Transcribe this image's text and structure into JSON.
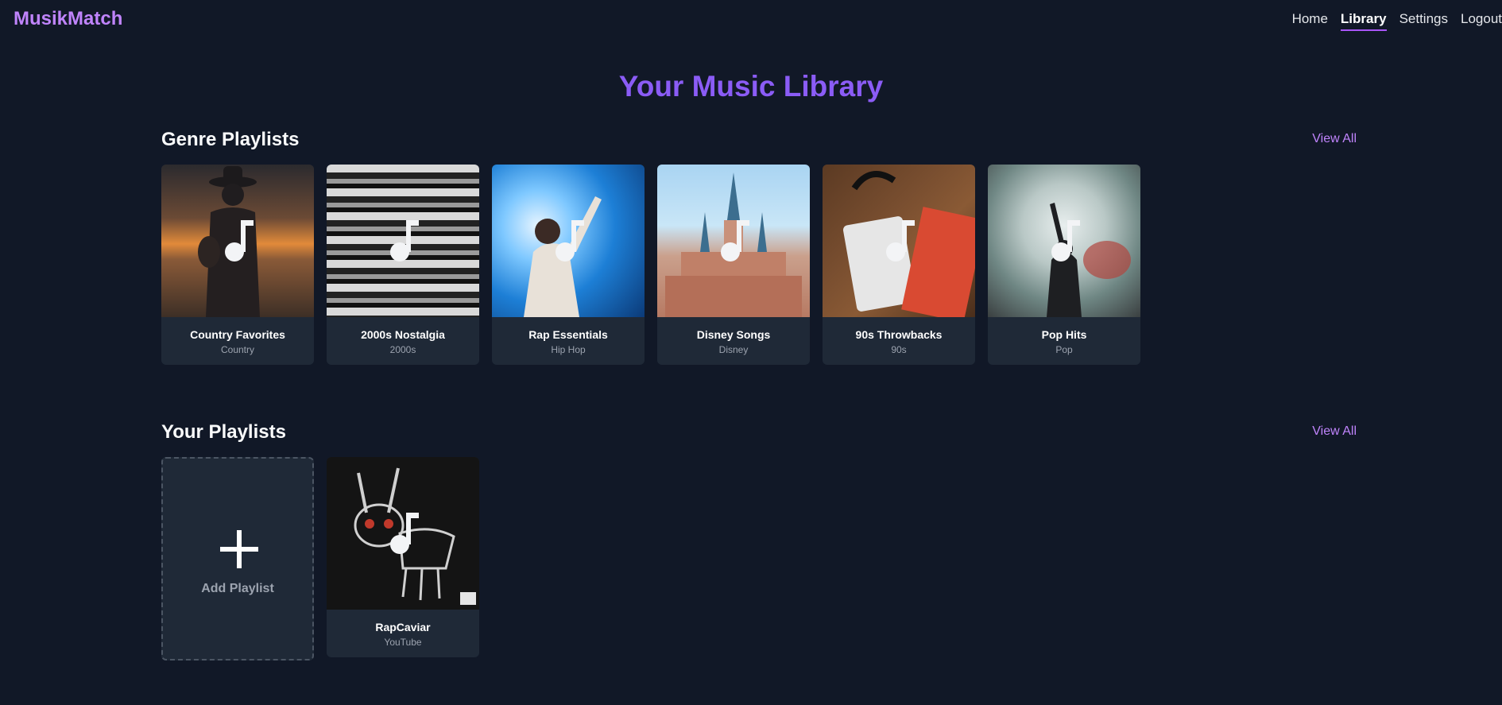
{
  "app": {
    "logo": "MusikMatch"
  },
  "nav": {
    "links": [
      {
        "label": "Home",
        "active": false
      },
      {
        "label": "Library",
        "active": true
      },
      {
        "label": "Settings",
        "active": false
      },
      {
        "label": "Logout",
        "active": false
      }
    ]
  },
  "page": {
    "title": "Your Music Library"
  },
  "genre_section": {
    "title": "Genre Playlists",
    "view_all": "View All",
    "cards": [
      {
        "title": "Country Favorites",
        "subtitle": "Country"
      },
      {
        "title": "2000s Nostalgia",
        "subtitle": "2000s"
      },
      {
        "title": "Rap Essentials",
        "subtitle": "Hip Hop"
      },
      {
        "title": "Disney Songs",
        "subtitle": "Disney"
      },
      {
        "title": "90s Throwbacks",
        "subtitle": "90s"
      },
      {
        "title": "Pop Hits",
        "subtitle": "Pop"
      }
    ]
  },
  "your_section": {
    "title": "Your Playlists",
    "view_all": "View All",
    "add_label": "Add Playlist",
    "cards": [
      {
        "title": "RapCaviar",
        "subtitle": "YouTube"
      }
    ]
  },
  "colors": {
    "background": "#111827",
    "card": "#1f2937",
    "accent": "#a855f7",
    "title": "#8b5cf6"
  },
  "icons": {
    "card_overlay": "music-note-icon",
    "add": "plus-icon"
  }
}
